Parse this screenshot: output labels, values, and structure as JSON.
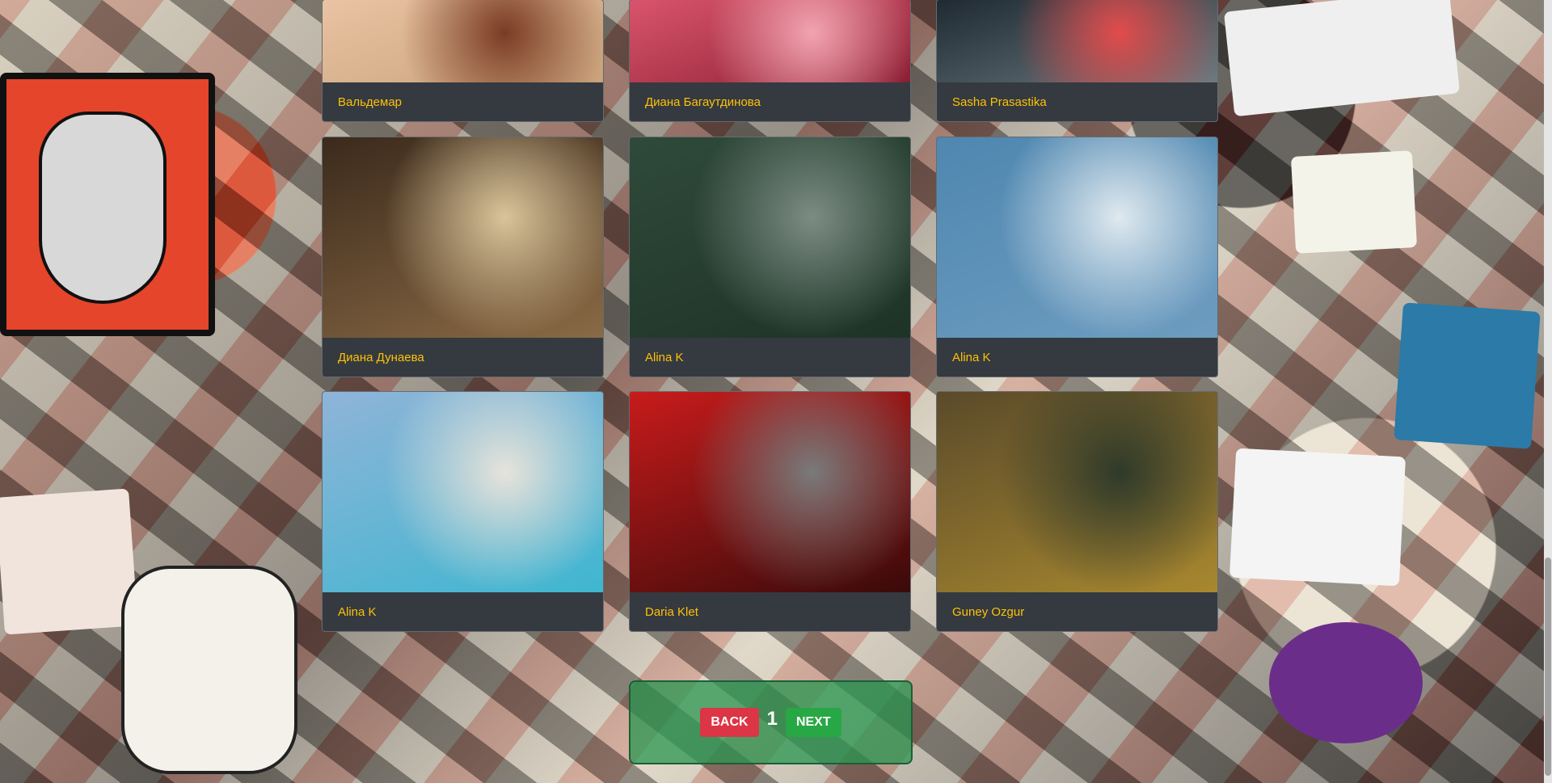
{
  "gallery": {
    "cards": [
      {
        "author": "Вальдемар",
        "image": "portrait-woman-earring",
        "colors": [
          "#e9c3a3",
          "#7a3b24",
          "#c9a27a"
        ]
      },
      {
        "author": "Диана Багаутдинова",
        "image": "pink-peony-flower",
        "colors": [
          "#d9546c",
          "#f2a3b0",
          "#8a1f33"
        ]
      },
      {
        "author": "Sasha Prasastika",
        "image": "neon-books-sign",
        "colors": [
          "#1f2a33",
          "#e24b4b",
          "#6c7b80"
        ]
      },
      {
        "author": "Диана Дунаева",
        "image": "window-balcony-view",
        "colors": [
          "#3b2a1c",
          "#d9c49a",
          "#8a6a45"
        ]
      },
      {
        "author": "Alina K",
        "image": "misty-forest",
        "colors": [
          "#2f4a3a",
          "#7c8c84",
          "#1e3326"
        ]
      },
      {
        "author": "Alina K",
        "image": "ferris-wheel-sky",
        "colors": [
          "#4f87b0",
          "#dfe9ef",
          "#6d9cc0"
        ]
      },
      {
        "author": "Alina K",
        "image": "white-cliff-sea",
        "colors": [
          "#8fb4d8",
          "#e7e3da",
          "#3fb6d0"
        ]
      },
      {
        "author": "Daria Klet",
        "image": "red-car-mirror-rain",
        "colors": [
          "#c81b1b",
          "#7a7a7a",
          "#3a0a0a"
        ]
      },
      {
        "author": "Guney Ozgur",
        "image": "hiker-forest-trail",
        "colors": [
          "#5a4a2a",
          "#2f3a2a",
          "#a8882f"
        ]
      }
    ]
  },
  "pagination": {
    "back_label": "BACK",
    "page": "1",
    "next_label": "NEXT"
  },
  "colors": {
    "caption_text": "#ffc107",
    "card_bg": "#343a40",
    "back_button": "#dc3545",
    "next_button": "#28a745"
  }
}
